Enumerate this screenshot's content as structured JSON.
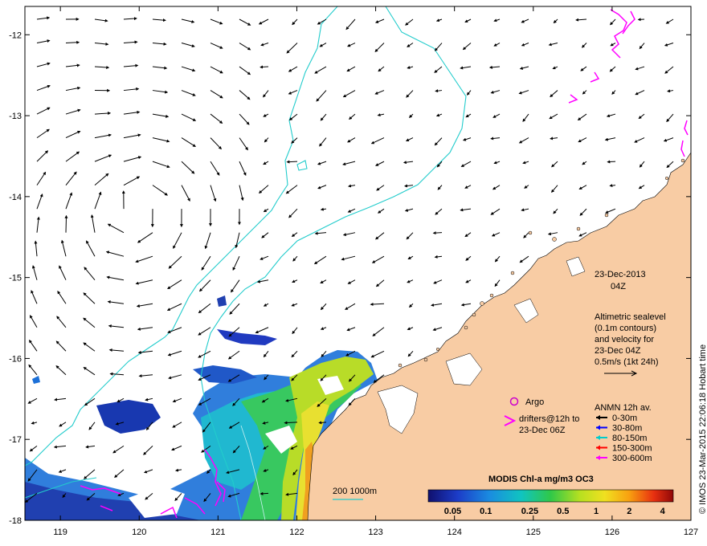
{
  "map": {
    "date_title": "23-Dec-2013",
    "time_title": "04Z",
    "altimetry_lines": [
      "Altimetric sealevel",
      "(0.1m contours)",
      "and velocity for",
      "23-Dec 04Z",
      "0.5m/s (1kt 24h)"
    ],
    "argo_label": "Argo",
    "drifters_lines": [
      "drifters@12h to",
      "23-Dec 06Z"
    ],
    "anmn_title": "ANMN 12h av.",
    "anmn_depths": [
      {
        "label": "0-30m",
        "color": "#000000"
      },
      {
        "label": "30-80m",
        "color": "#0000ff"
      },
      {
        "label": "80-150m",
        "color": "#00cccc"
      },
      {
        "label": "150-300m",
        "color": "#ff0000"
      },
      {
        "label": "300-600m",
        "color": "#ff00ff"
      }
    ],
    "colorbar_title": "MODIS Chl-a mg/m3 OC3",
    "colorbar_ticks": [
      "0.05",
      "0.1",
      "0.25",
      "0.5",
      "1",
      "2",
      "4"
    ],
    "isobath_label": "200  1000m",
    "credit": "© IMOS 23-Mar-2015 22:06:18 Hobart time",
    "x_ticks": [
      "119",
      "120",
      "121",
      "122",
      "123",
      "124",
      "125",
      "126",
      "127"
    ],
    "y_ticks": [
      "-12",
      "-13",
      "-14",
      "-15",
      "-16",
      "-17",
      "-18"
    ],
    "colors": {
      "land": "#f8cca4",
      "isobath": "#22cccc",
      "drifter": "#ff00ff"
    }
  }
}
